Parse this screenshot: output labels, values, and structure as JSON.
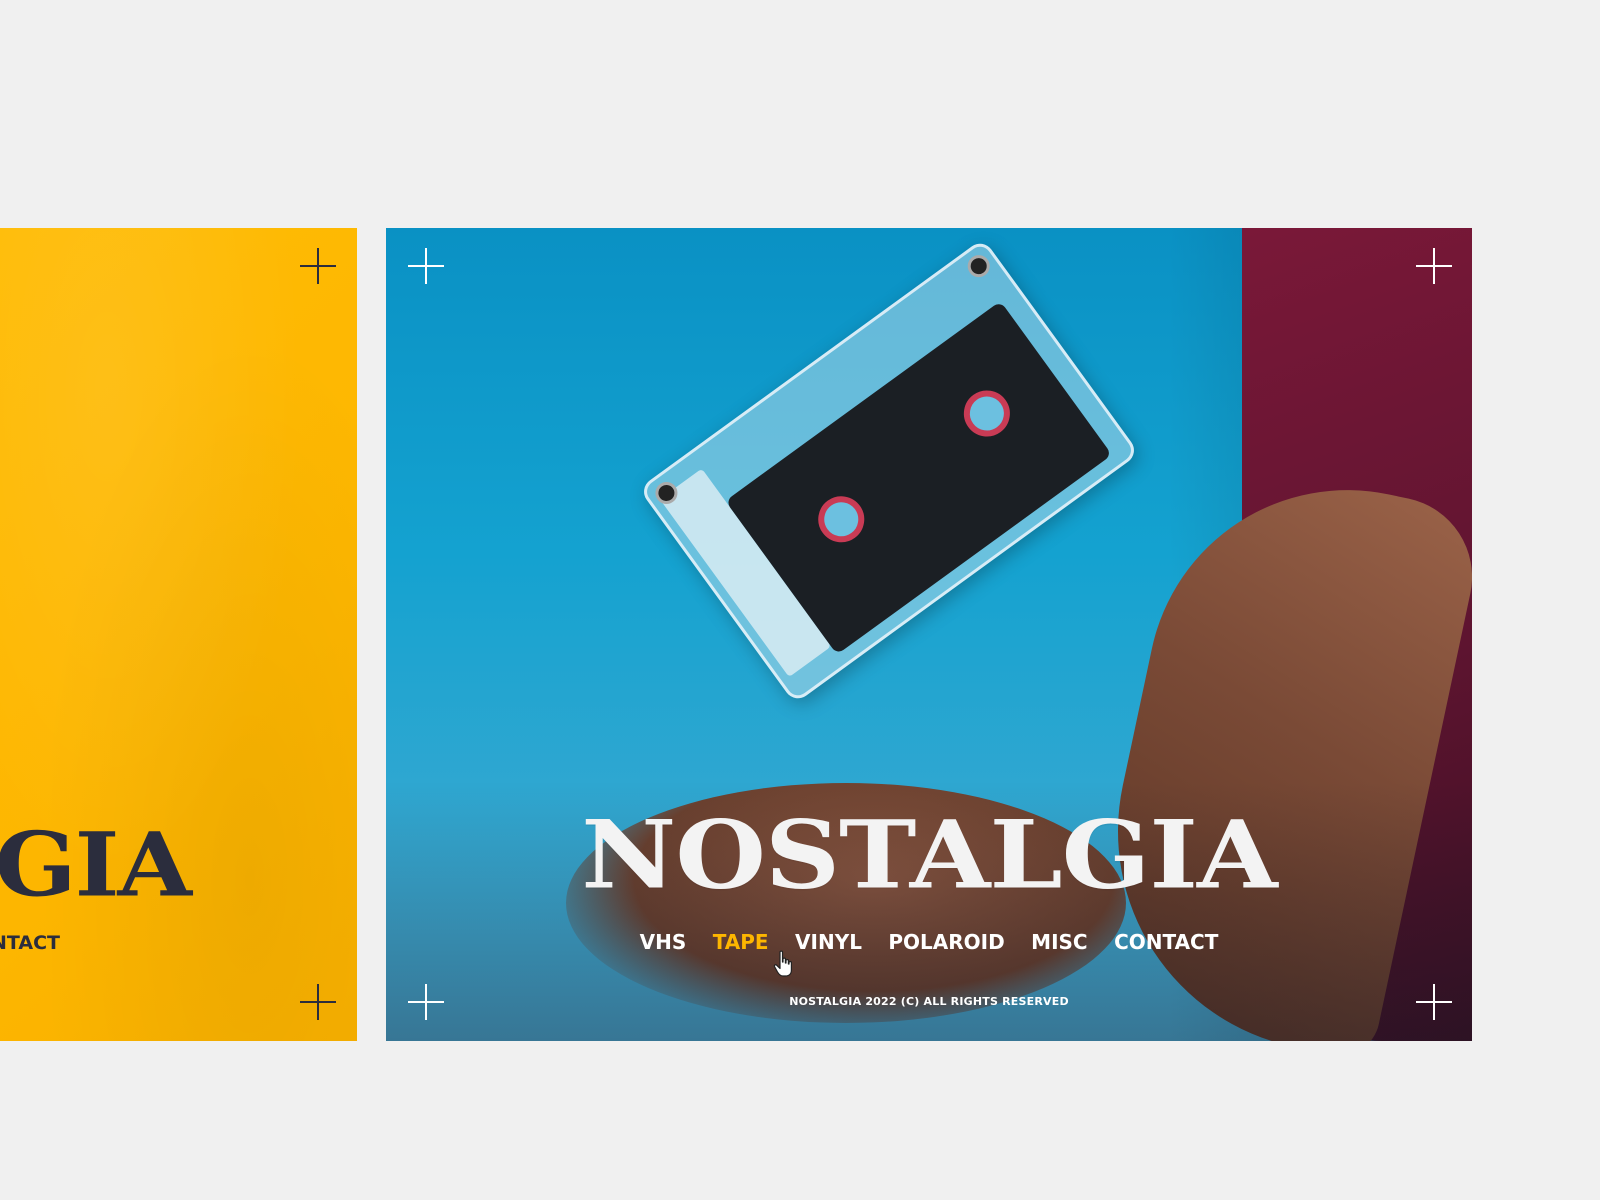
{
  "left_card": {
    "title_fragment": "GIA",
    "nav_fragment": "NTACT",
    "background_color": "#fdb600",
    "icons": [
      "crosshair-icon",
      "crosshair-icon"
    ]
  },
  "main_card": {
    "title": "NOSTALGIA",
    "nav": [
      {
        "label": "VHS",
        "active": false
      },
      {
        "label": "TAPE",
        "active": true
      },
      {
        "label": "VINYL",
        "active": false
      },
      {
        "label": "POLAROID",
        "active": false
      },
      {
        "label": "MISC",
        "active": false
      },
      {
        "label": "CONTACT",
        "active": false
      }
    ],
    "footer": "NOSTALGIA 2022 (C) ALL RIGHTS RESERVED",
    "accent_color": "#fdb600",
    "icons": [
      "crosshair-icon",
      "crosshair-icon",
      "crosshair-icon",
      "crosshair-icon",
      "hand-pointer-icon"
    ]
  }
}
